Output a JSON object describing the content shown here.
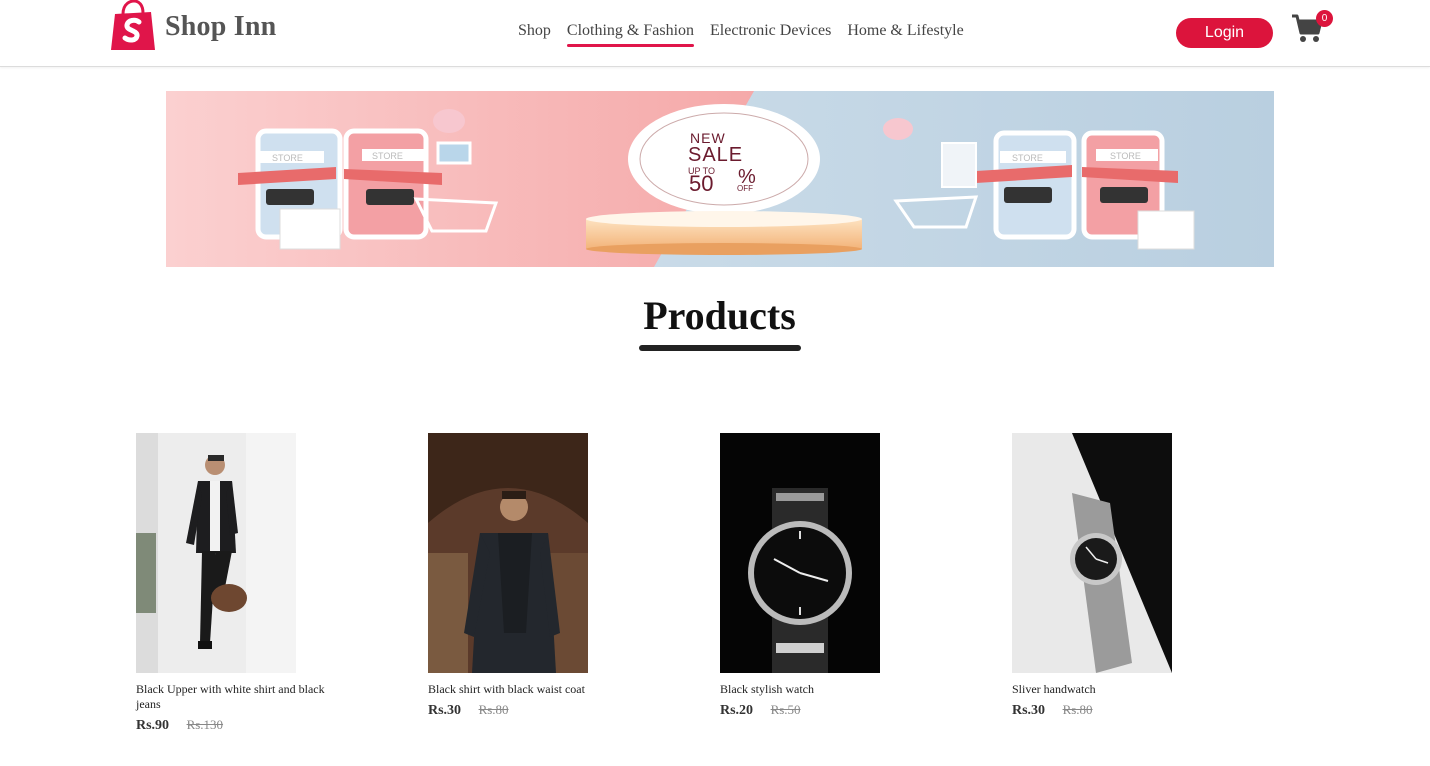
{
  "header": {
    "brand": "Shop Inn",
    "nav": [
      {
        "label": "Shop",
        "active": false
      },
      {
        "label": "Clothing & Fashion",
        "active": true
      },
      {
        "label": "Electronic Devices",
        "active": false
      },
      {
        "label": "Home & Lifestyle",
        "active": false
      }
    ],
    "login_label": "Login",
    "cart_count": "0"
  },
  "banner": {
    "line1": "NEW",
    "line2": "SALE",
    "line3": "UP TO",
    "line4": "50",
    "line5": "%",
    "line6": "OFF",
    "store_label": "STORE"
  },
  "products_section": {
    "title": "Products"
  },
  "products": [
    {
      "name": "Black Upper with white shirt and black jeans",
      "price": "Rs.90",
      "old_price": "Rs.130"
    },
    {
      "name": "Black shirt with black waist coat",
      "price": "Rs.30",
      "old_price": "Rs.80"
    },
    {
      "name": "Black stylish watch",
      "price": "Rs.20",
      "old_price": "Rs.50"
    },
    {
      "name": "Sliver handwatch",
      "price": "Rs.30",
      "old_price": "Rs.80"
    }
  ],
  "colors": {
    "accent": "#dc143c",
    "banner_left": "#f7b5b5",
    "banner_right": "#c5d8e6"
  }
}
